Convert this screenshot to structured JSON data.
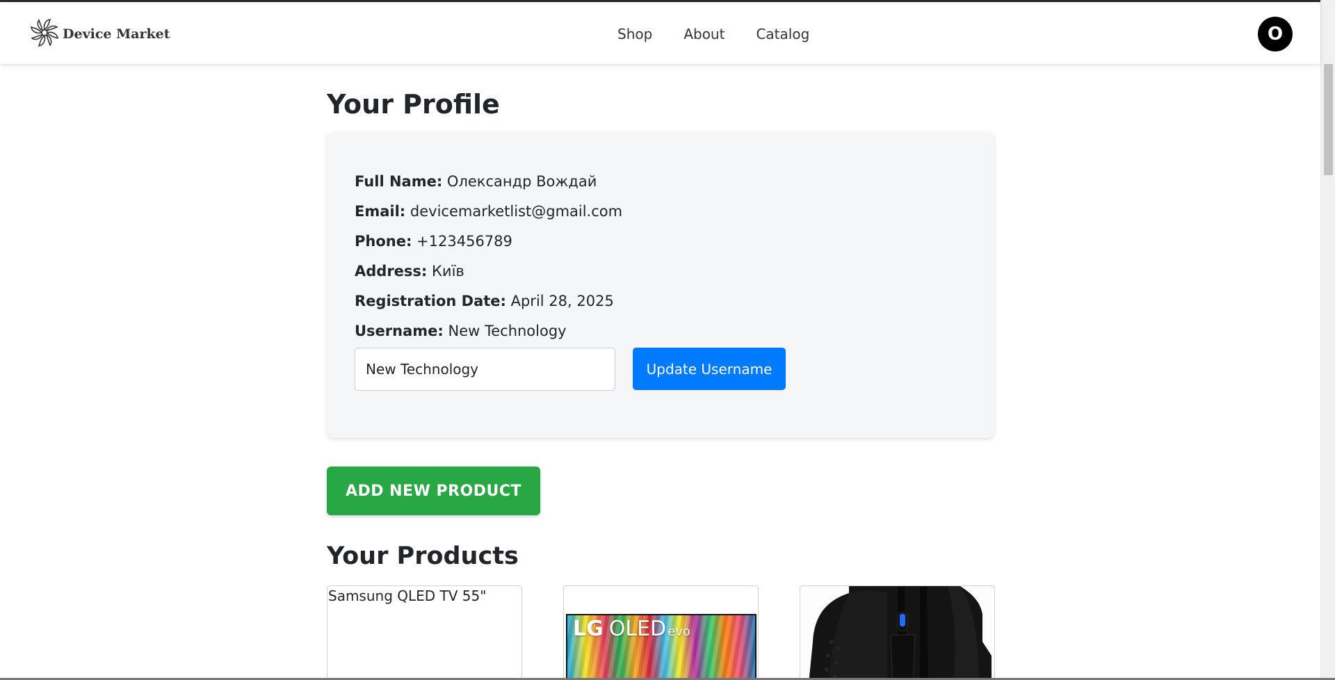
{
  "header": {
    "brand": "Device Market",
    "nav": [
      "Shop",
      "About",
      "Catalog"
    ],
    "avatar_letter": "O"
  },
  "profile": {
    "title": "Your Profile",
    "fields": [
      {
        "label": "Full Name:",
        "value": "Олександр Вождай"
      },
      {
        "label": "Email:",
        "value": "devicemarketlist@gmail.com"
      },
      {
        "label": "Phone:",
        "value": "+123456789"
      },
      {
        "label": "Address:",
        "value": "Київ"
      },
      {
        "label": "Registration Date:",
        "value": "April 28, 2025"
      },
      {
        "label": "Username:",
        "value": "New Technology"
      }
    ],
    "username_input_value": "New Technology",
    "update_button": "Update Username"
  },
  "add_product_button": "ADD NEW PRODUCT",
  "products_section": {
    "title": "Your Products",
    "items": [
      {
        "name": "Samsung QLED TV 55\"",
        "image": "broken-image"
      },
      {
        "name": "",
        "image": "lg-oled-evo",
        "image_text": [
          "LG",
          "OLED",
          "evo"
        ]
      },
      {
        "name": "",
        "image": "gaming-mouse",
        "accent": "#1e6bff"
      }
    ]
  },
  "colors": {
    "primary": "#007bff",
    "success": "#28a745",
    "card_bg": "#f5f6f8"
  }
}
